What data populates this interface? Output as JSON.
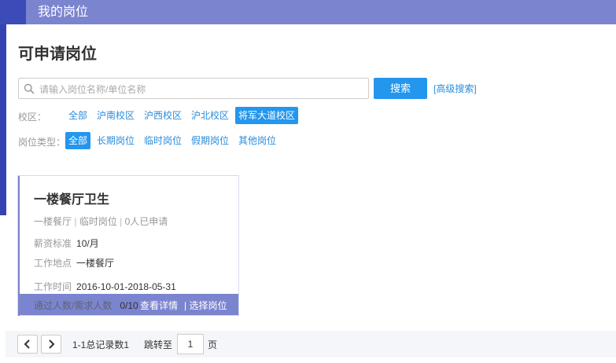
{
  "header": {
    "title": "我的岗位"
  },
  "page": {
    "title": "可申请岗位"
  },
  "search": {
    "placeholder": "请输入岗位名称/单位名称",
    "value": "",
    "button_label": "搜索",
    "advanced_label": "[高级搜索]"
  },
  "filters": {
    "campus": {
      "label": "校区：",
      "options": [
        "全部",
        "沪南校区",
        "沪西校区",
        "沪北校区",
        "将军大道校区"
      ],
      "selected": "将军大道校区"
    },
    "type": {
      "label": "岗位类型：",
      "options": [
        "全部",
        "长期岗位",
        "临时岗位",
        "假期岗位",
        "其他岗位"
      ],
      "selected": "全部"
    }
  },
  "jobs": [
    {
      "title": "一楼餐厅卫生",
      "location_tag": "一楼餐厅",
      "job_type": "临时岗位",
      "applied": "0人已申请",
      "salary_label": "薪资标准",
      "salary": "10/月",
      "place_label": "工作地点",
      "place": "一楼餐厅",
      "time_label": "工作时间",
      "time": "2016-10-01-2018-05-31",
      "count_label": "通过人数/需求人数",
      "count": "0/10",
      "details_label": "查看详情",
      "select_label": "| 选择岗位"
    }
  ],
  "pagination": {
    "info": "1-1总记录数1",
    "jump_label": "跳转至",
    "page": "1",
    "unit": "页"
  },
  "colors": {
    "header": "#7b84ce",
    "accent": "#2396ee",
    "link": "#2a8cdb"
  },
  "icons": {
    "search": "search-icon",
    "prev": "chevron-left-icon",
    "next": "chevron-right-icon"
  }
}
